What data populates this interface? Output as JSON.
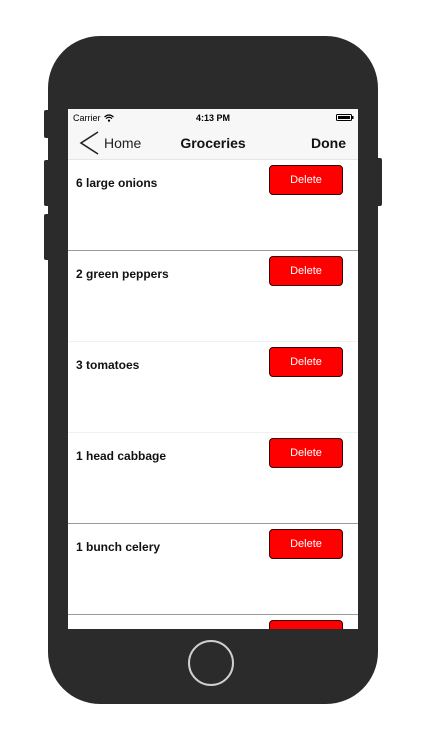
{
  "status_bar": {
    "carrier": "Carrier",
    "time": "4:13 PM",
    "wifi_icon": "wifi-icon",
    "battery_icon": "battery-icon"
  },
  "nav_bar": {
    "back_label": "Home",
    "back_icon": "chevron-left-icon",
    "title": "Groceries",
    "done_label": "Done"
  },
  "items": [
    {
      "label": "6 large onions",
      "delete_label": "Delete"
    },
    {
      "label": "2 green peppers",
      "delete_label": "Delete"
    },
    {
      "label": "3 tomatoes",
      "delete_label": "Delete"
    },
    {
      "label": "1 head cabbage",
      "delete_label": "Delete"
    },
    {
      "label": "1 bunch celery",
      "delete_label": "Delete"
    }
  ],
  "colors": {
    "delete_button": "#ff0000",
    "delete_text": "#ffffff",
    "phone_body": "#2b2b2b",
    "bar_background": "#f7f7f7"
  }
}
